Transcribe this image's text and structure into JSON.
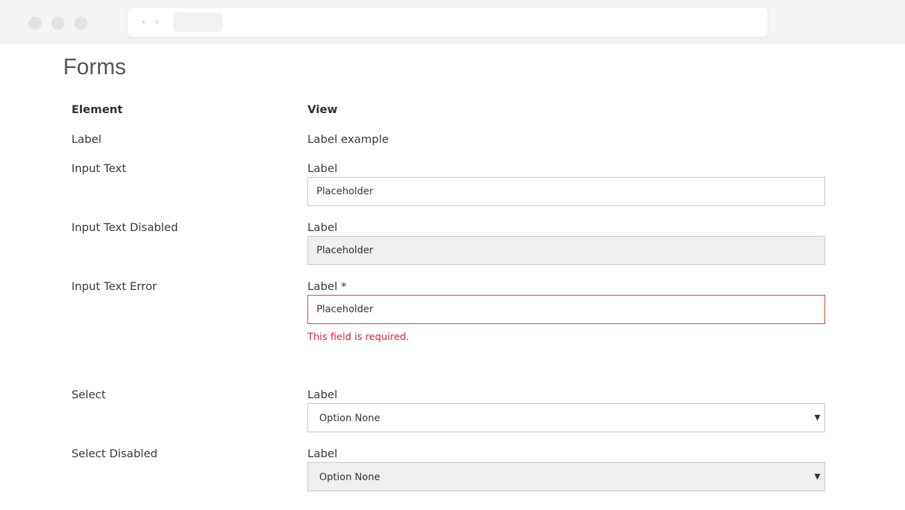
{
  "page": {
    "title": "Forms"
  },
  "table": {
    "headers": {
      "element": "Element",
      "view": "View"
    },
    "rows": [
      {
        "element": "Label",
        "view_text": "Label example"
      },
      {
        "element": "Input Text",
        "label": "Label",
        "placeholder": "Placeholder"
      },
      {
        "element": "Input Text Disabled",
        "label": "Label",
        "placeholder": "Placeholder"
      },
      {
        "element": "Input Text Error",
        "label": "Label *",
        "placeholder": "Placeholder",
        "error": "This field is required."
      },
      {
        "element": "Select",
        "label": "Label",
        "selected": "Option None"
      },
      {
        "element": "Select Disabled",
        "label": "Label",
        "selected": "Option None"
      }
    ]
  },
  "icons": {
    "back": "chevron-left-icon",
    "forward": "chevron-right-icon",
    "select_arrow": "caret-down-icon"
  },
  "colors": {
    "error": "#d0283b",
    "error_border": "#d33c3c",
    "disabled_bg": "#efefef",
    "border": "#c6c6c6"
  }
}
